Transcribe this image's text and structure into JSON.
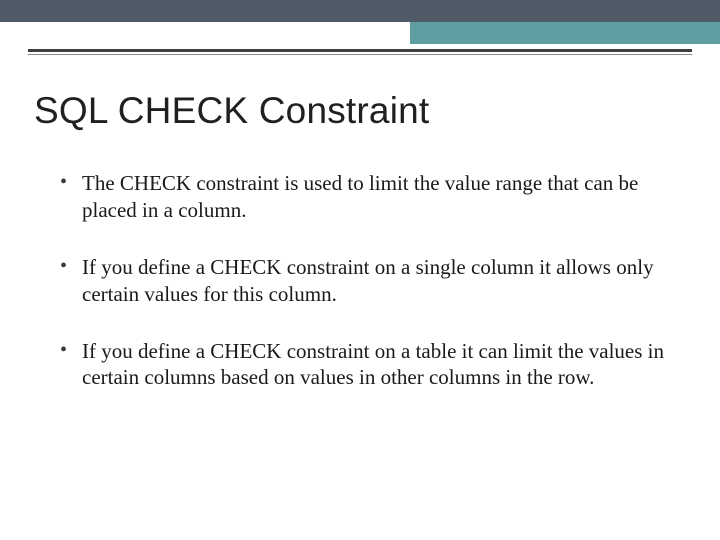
{
  "title": "SQL CHECK Constraint",
  "bullets": [
    "The CHECK constraint is used to limit the value range that can be placed in a column.",
    "If you define a CHECK constraint on a single column it allows only certain values for this column.",
    "If you define a CHECK constraint on a table it can limit the values in certain columns based on values in other columns in the row."
  ]
}
